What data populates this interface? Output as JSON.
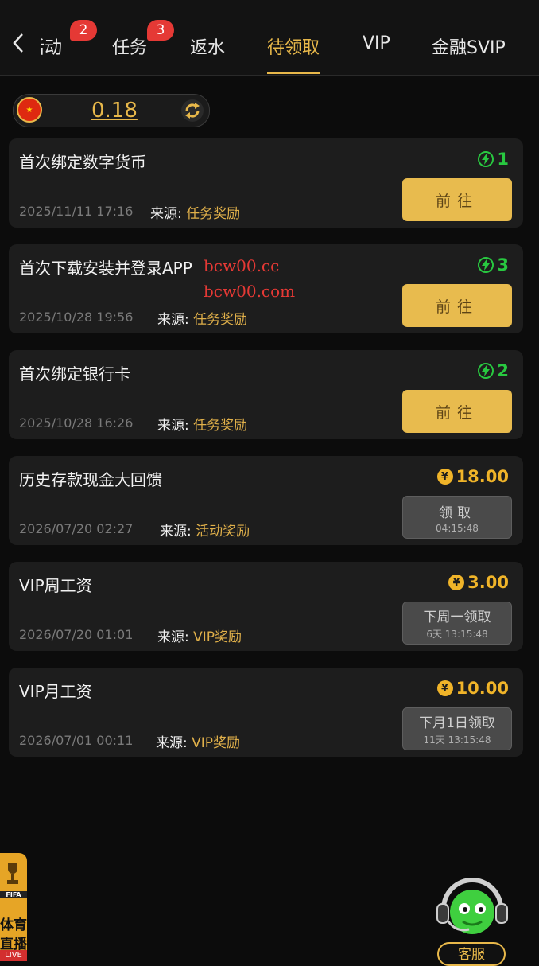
{
  "header": {
    "tabs": [
      {
        "label": "活动",
        "badge": "2"
      },
      {
        "label": "任务",
        "badge": "3"
      },
      {
        "label": "返水"
      },
      {
        "label": "待领取",
        "active": true
      },
      {
        "label": "VIP"
      },
      {
        "label": "金融SVIP"
      }
    ]
  },
  "balance": {
    "amount": "0.18"
  },
  "rewards": [
    {
      "title": "首次绑定数字货币",
      "date": "2025/11/11 17:16",
      "source_label": "来源:",
      "source": "任务奖励",
      "amount": "1",
      "amount_type": "bolt",
      "button": "前往"
    },
    {
      "title": "首次下载安装并登录APP",
      "date": "2025/10/28 19:56",
      "source_label": "来源:",
      "source": "任务奖励",
      "amount": "3",
      "amount_type": "bolt",
      "button": "前往"
    },
    {
      "title": "首次绑定银行卡",
      "date": "2025/10/28 16:26",
      "source_label": "来源:",
      "source": "任务奖励",
      "amount": "2",
      "amount_type": "bolt",
      "button": "前往"
    },
    {
      "title": "历史存款现金大回馈",
      "date": "2026/07/20 02:27",
      "source_label": "来源:",
      "source": "活动奖励",
      "amount": "18.00",
      "amount_type": "coin",
      "button": "领取",
      "button_sub": "04:15:48"
    },
    {
      "title": "VIP周工资",
      "date": "2026/07/20 01:01",
      "source_label": "来源:",
      "source": "VIP奖励",
      "amount": "3.00",
      "amount_type": "coin",
      "button": "下周一领取",
      "button_sub": "6天 13:15:48"
    },
    {
      "title": "VIP月工资",
      "date": "2026/07/01 00:11",
      "source_label": "来源:",
      "source": "VIP奖励",
      "amount": "10.00",
      "amount_type": "coin",
      "button": "下月1日领取",
      "button_sub": "11天 13:15:48"
    }
  ],
  "watermark": [
    "bcw00.cc",
    "bcw00.com"
  ],
  "live_badge": {
    "line1": "体育",
    "line2": "直播",
    "tag": "LIVE",
    "logo": "FIFA"
  },
  "support": {
    "label": "客服"
  },
  "colors": {
    "accent": "#e8b84a",
    "bolt": "#28c840",
    "coin": "#f0b429",
    "card": "#1d1d1d"
  }
}
